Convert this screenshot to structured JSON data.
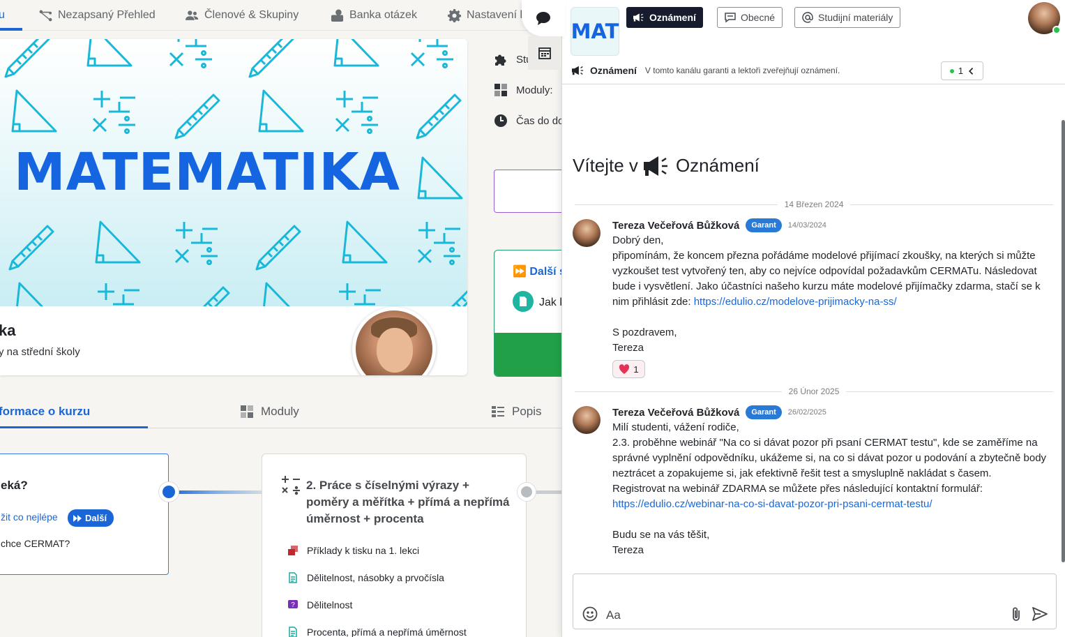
{
  "topnav": {
    "partial_tab": "u",
    "tabs": [
      {
        "label": "Nezapsaný Přehled",
        "icon": "hierarchy-icon"
      },
      {
        "label": "Členové & Skupiny",
        "icon": "users-icon"
      },
      {
        "label": "Banka otázek",
        "icon": "question-bank-icon"
      },
      {
        "label": "Nastavení k",
        "icon": "gear-icon"
      }
    ]
  },
  "banner": {
    "title": "MATEMATIKA",
    "course_title": "ka",
    "course_subtitle": "y na střední školy"
  },
  "info": {
    "study": "Stu",
    "modules": "Moduly:",
    "time": "Čas do do"
  },
  "next_card": {
    "label": "Další s",
    "item": "Jak k"
  },
  "subtabs": [
    {
      "label": "formace o kurzu",
      "icon": ""
    },
    {
      "label": "Moduly",
      "icon": "puzzle-icon"
    },
    {
      "label": "Popis",
      "icon": "list-icon"
    }
  ],
  "module1": {
    "question": "eká?",
    "link": "žit co nejlépe",
    "badge": "Další",
    "cermat": "chce CERMAT?"
  },
  "module2": {
    "title": "2. Práce s číselnými výrazy + poměry a měřítka + přímá a nepřímá úměrnost + procenta",
    "items": [
      {
        "label": "Příklady k tisku na 1. lekci",
        "icon": "print-icon",
        "color": "#c0282d"
      },
      {
        "label": "Dělitelnost, násobky a prvočísla",
        "icon": "document-icon",
        "color": "#18a9a0"
      },
      {
        "label": "Dělitelnost",
        "icon": "quiz-icon",
        "color": "#7a2fb8"
      },
      {
        "label": "Procenta, přímá a nepřímá úměrnost",
        "icon": "document-icon",
        "color": "#18a9a0"
      }
    ]
  },
  "chat": {
    "logo": "MAT",
    "channels": [
      {
        "label": "Oznámení",
        "icon": "megaphone-icon",
        "active": true
      },
      {
        "label": "Obecné",
        "icon": "chat-icon",
        "active": false
      },
      {
        "label": "Studijní materiály",
        "icon": "at-icon",
        "active": false
      }
    ],
    "channel_name": "Oznámení",
    "channel_desc": "V tomto kanálu garanti a lektoři zveřejňují oznámení.",
    "members_online": "1",
    "welcome_prefix": "Vítejte v",
    "welcome_channel": "Oznámení",
    "composer_placeholder": "Aa",
    "messages": [
      {
        "date_sep": "14 Březen 2024",
        "author": "Tereza Večeřová Bůžková",
        "role": "Garant",
        "time": "14/03/2024",
        "lines": [
          "Dobrý den,",
          "připomínám, že koncem přezna pořádáme modelové přijímací zkoušky, na kterých si můžte",
          "vyzkoušet test vytvořený ten, aby co nejvíce odpovídal požadavkům CERMATu. Následovat",
          "bude i vysvětlení. Jako účastníci našeho kurzu máte modelové přijímačky zdarma, stačí se k"
        ],
        "link_prefix": "nim přihlásit zde: ",
        "link": "https://edulio.cz/modelove-prijimacky-na-ss/",
        "closing": [
          "S pozdravem,",
          "Tereza"
        ],
        "reaction_count": "1"
      },
      {
        "date_sep": "26 Únor 2025",
        "author": "Tereza Večeřová Bůžková",
        "role": "Garant",
        "time": "26/02/2025",
        "lines": [
          "Milí studenti, vážení rodiče,",
          "2.3. proběhne webinář \"Na co si dávat pozor při psaní CERMAT testu\", kde se zaměříme na",
          "správné vyplnění odpovědníku, ukážeme si, na co si dávat pozor u podování a zbytečně body",
          "neztrácet a zopakujeme si, jak efektivně řešit test a smysluplně nakládat s časem.",
          "Registrovat na webinář ZDARMA se můžete přes následující kontaktní formulář:"
        ],
        "link": "https://edulio.cz/webinar-na-co-si-davat-pozor-pri-psani-cermat-testu/",
        "closing": [
          "Budu se na vás těšit,",
          "Tereza"
        ]
      }
    ]
  },
  "colors": {
    "accent": "#1a66d6",
    "brand_blue": "#1565e0",
    "pattern_cyan": "#19b8d8",
    "success_green": "#22a048",
    "channel_active_bg": "#161b2e",
    "role_badge": "#2979d6"
  }
}
